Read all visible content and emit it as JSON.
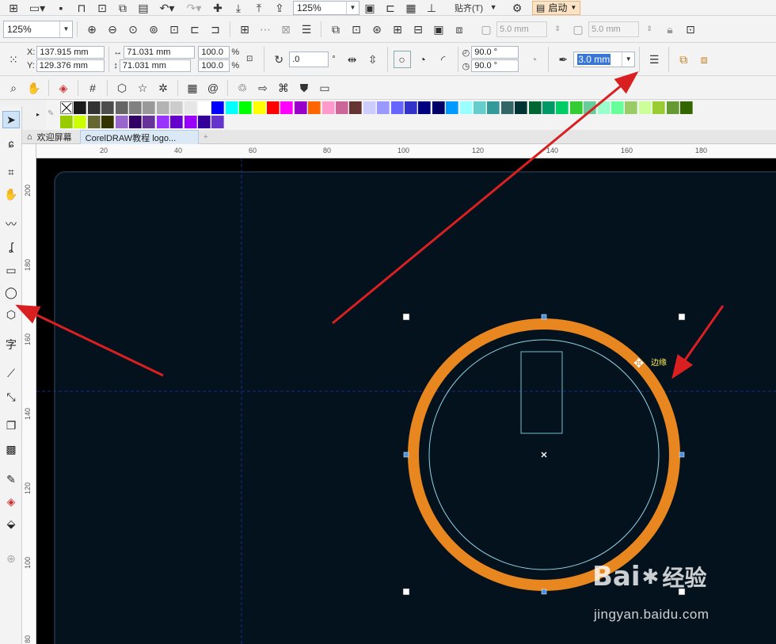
{
  "standard_toolbar": {
    "zoom_value": "125%",
    "snap_label": "贴齐(T)",
    "launch_label": "启动",
    "icons": [
      "new-icon",
      "open-icon",
      "save-icon",
      "print-icon",
      "import-icon",
      "export-icon",
      "undo-icon",
      "redo-icon",
      "search-icon",
      "upload-icon",
      "download-icon",
      "fullscreen-icon",
      "grid-icon",
      "ruler-icon",
      "settings-icon"
    ]
  },
  "zoom_toolbar": {
    "zoom_value": "125%",
    "offset_x": "5.0 mm",
    "offset_y": "5.0 mm"
  },
  "property_bar": {
    "x_label": "X:",
    "x_value": "137.915 mm",
    "y_label": "Y:",
    "y_value": "129.376 mm",
    "width_value": "71.031 mm",
    "height_value": "71.031 mm",
    "scale_x": "100.0",
    "scale_y": "100.0",
    "percent": "%",
    "rotation_value": ".0",
    "degree": "°",
    "start_angle": "90.0 °",
    "end_angle": "90.0 °",
    "outline_width": "3.0 mm"
  },
  "palette": {
    "colors": [
      "#000000",
      "#1a1a1a",
      "#333333",
      "#4d4d4d",
      "#666666",
      "#808080",
      "#999999",
      "#b3b3b3",
      "#cccccc",
      "#e6e6e6",
      "#ffffff",
      "#0000ff",
      "#00ffff",
      "#00ff00",
      "#ffff00",
      "#ff0000",
      "#ff00ff",
      "#9900cc",
      "#ff6600",
      "#ff99cc",
      "#cc6699",
      "#663333",
      "#ccccff",
      "#9999ff",
      "#6666ff",
      "#3333cc",
      "#000080",
      "#000066",
      "#0099ff",
      "#99ffff",
      "#66cccc",
      "#339999",
      "#336666",
      "#003333",
      "#006633",
      "#009966",
      "#00cc66",
      "#33cc33",
      "#66cc99",
      "#99ffcc",
      "#66ff99",
      "#99cc66",
      "#ccff99",
      "#99cc33",
      "#669933",
      "#336600",
      "#99cc00",
      "#ccff00",
      "#666633",
      "#333300",
      "#9966cc",
      "#330066",
      "#663399",
      "#9933ff",
      "#6600cc",
      "#9900ff",
      "#330099",
      "#6633cc"
    ]
  },
  "tabs": [
    {
      "label": "欢迎屏幕"
    },
    {
      "label": "CorelDRAW教程 logo..."
    }
  ],
  "ruler_top_labels": [
    "20",
    "40",
    "60",
    "80",
    "100",
    "120",
    "140",
    "160",
    "180"
  ],
  "ruler_left_labels": [
    "200",
    "180",
    "160",
    "140",
    "120",
    "100",
    "80"
  ],
  "canvas": {
    "hover_label": "边缘",
    "ring_color": "#e8861f",
    "guide_color": "#1a2a8a",
    "page_color": "#04121e"
  },
  "watermark": {
    "brand": "Bai",
    "brand_suffix": "经验",
    "url": "jingyan.baidu.com"
  },
  "annotation_color": "#d92020"
}
